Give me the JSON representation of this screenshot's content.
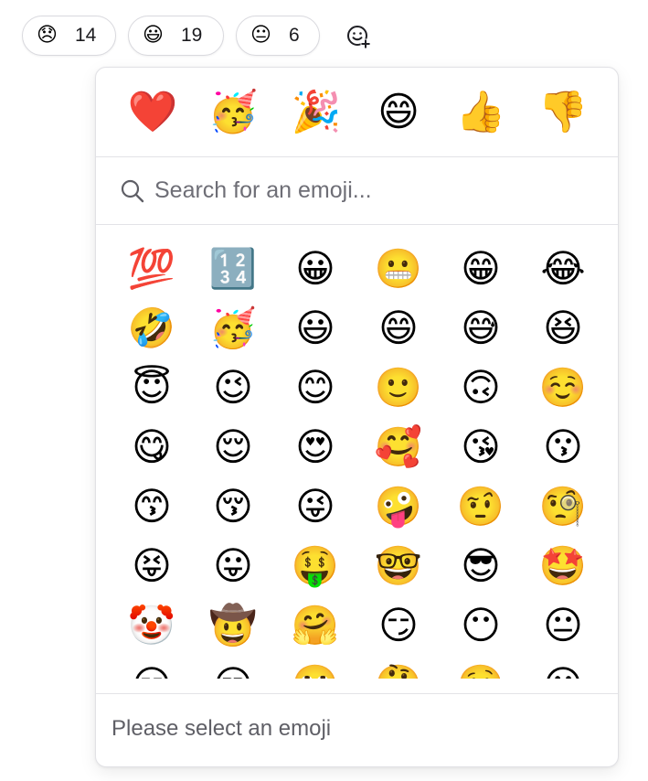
{
  "reactions": [
    {
      "emoji": "😞",
      "icon": "disappointed-face-icon",
      "count": "14"
    },
    {
      "emoji": "😃",
      "icon": "grinning-face-big-eyes-icon",
      "count": "19"
    },
    {
      "emoji": "😐",
      "icon": "neutral-face-icon",
      "count": "6"
    }
  ],
  "add_reaction_icon": "add-reaction-smiley-icon",
  "quick_reactions": [
    {
      "emoji": "❤️",
      "icon": "red-heart-icon"
    },
    {
      "emoji": "🥳",
      "icon": "partying-face-icon"
    },
    {
      "emoji": "🎉",
      "icon": "party-popper-icon"
    },
    {
      "emoji": "😄",
      "icon": "grinning-face-smiling-eyes-icon"
    },
    {
      "emoji": "👍",
      "icon": "thumbs-up-icon"
    },
    {
      "emoji": "👎",
      "icon": "thumbs-down-icon"
    }
  ],
  "search": {
    "placeholder": "Search for an emoji...",
    "value": ""
  },
  "emoji_grid": [
    "💯",
    "🔢",
    "😀",
    "😬",
    "😁",
    "😂",
    "🤣",
    "🥳",
    "😃",
    "😄",
    "😅",
    "😆",
    "😇",
    "😉",
    "😊",
    "🙂",
    "🙃",
    "☺️",
    "😋",
    "😌",
    "😍",
    "🥰",
    "😘",
    "😗",
    "😙",
    "😚",
    "😜",
    "🤪",
    "🤨",
    "🧐",
    "😝",
    "😛",
    "🤑",
    "🤓",
    "😎",
    "🤩",
    "🤡",
    "🤠",
    "🤗",
    "😏",
    "😶",
    "😐",
    "😑",
    "😒",
    "🙄",
    "🤔",
    "🤥",
    "😮"
  ],
  "footer": {
    "text": "Please select an emoji"
  },
  "colors": {
    "border": "#e1e1e5",
    "placeholder": "#6e6e76",
    "footer_text": "#5f5f66"
  }
}
